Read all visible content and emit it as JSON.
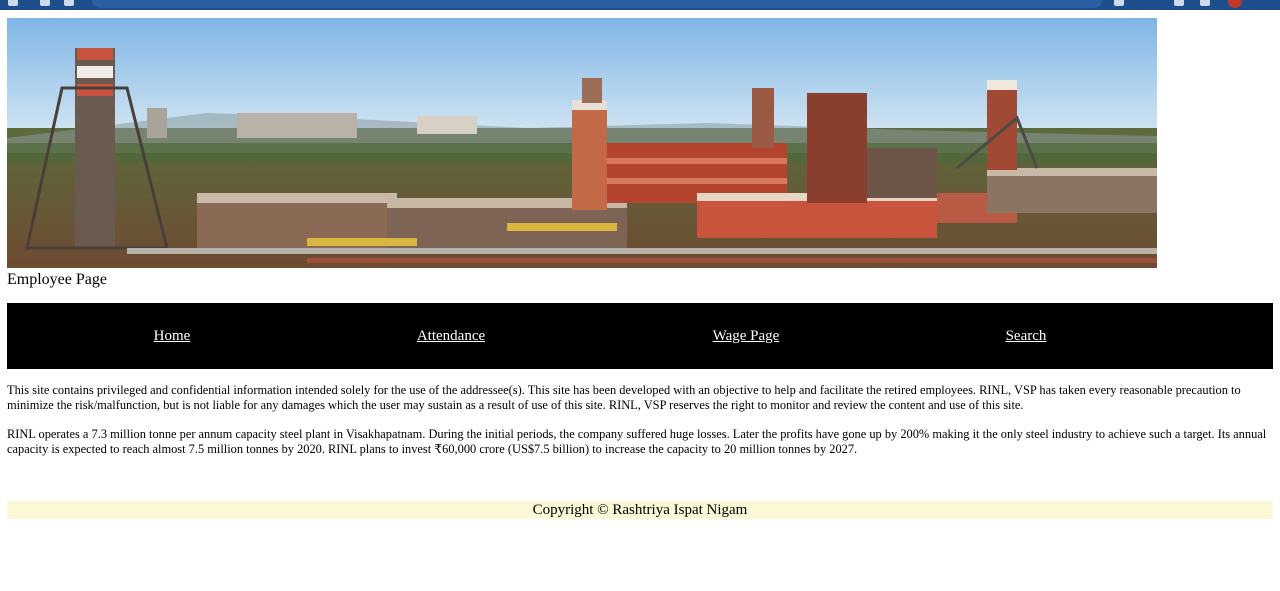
{
  "browser": {
    "colors": {
      "toolbar": "#1f4e8c"
    }
  },
  "page": {
    "heading": "Employee Page",
    "banner": {
      "description_icon": "steel-plant-photo"
    }
  },
  "nav": {
    "items": [
      {
        "label": "Home"
      },
      {
        "label": "Attendance"
      },
      {
        "label": "Wage Page"
      },
      {
        "label": "Search"
      }
    ],
    "colors": {
      "background": "#000000",
      "text": "#ffffff"
    }
  },
  "content": {
    "disclaimer": "This site contains privileged and confidential information intended solely for the use of the addressee(s). This site has been developed with an objective to help and facilitate the retired employees. RINL, VSP has taken every reasonable precaution to minimize the risk/malfunction, but is not liable for any damages which the user may sustain as a result of use of this site. RINL, VSP reserves the right to monitor and review the content and use of this site.",
    "about": "RINL operates a 7.3 million tonne per annum capacity steel plant in Visakhapatnam. During the initial periods, the company suffered huge losses. Later the profits have gone up by 200% making it the only steel industry to achieve such a target. Its annual capacity is expected to reach almost 7.5 million tonnes by 2020. RINL plans to invest ₹60,000 crore (US$7.5 billion) to increase the capacity to 20 million tonnes by 2027."
  },
  "footer": {
    "copyright": "Copyright © Rashtriya Ispat Nigam",
    "colors": {
      "background": "#fbf8d6"
    }
  }
}
